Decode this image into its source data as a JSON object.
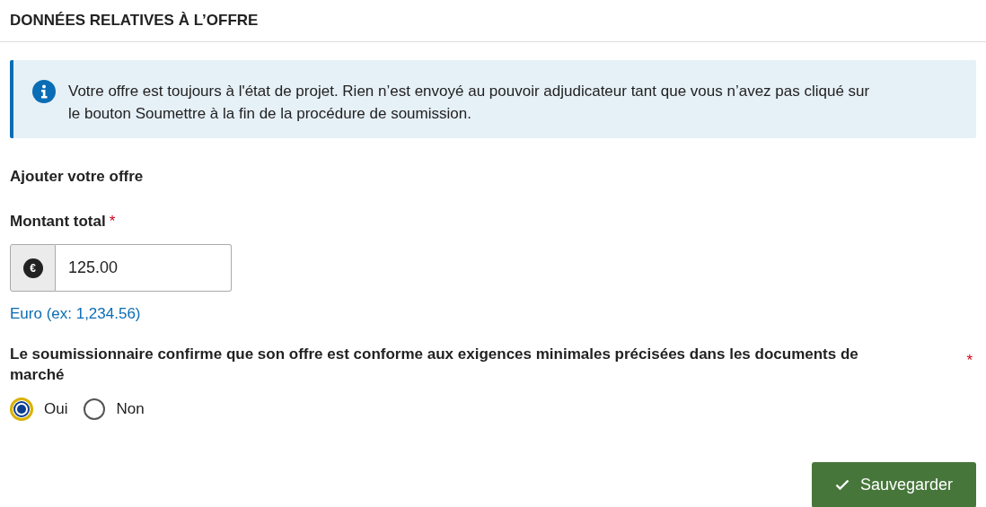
{
  "section_title": "DONNÉES RELATIVES À L’OFFRE",
  "info_message": "Votre offre est toujours à l'état de projet. Rien n’est envoyé au pouvoir adjudicateur tant que vous n’avez pas cliqué sur le bouton Soumettre à la fin de la procédure de soumission.",
  "subtitle": "Ajouter votre offre",
  "amount": {
    "label": "Montant total",
    "required_mark": "*",
    "currency_symbol": "€",
    "value": "125.00",
    "hint": "Euro (ex: 1,234.56)"
  },
  "confirmation": {
    "question": "Le soumissionnaire confirme que son offre est conforme aux exigences minimales précisées dans les documents de marché",
    "required_mark": "*",
    "options": [
      {
        "label": "Oui",
        "selected": true
      },
      {
        "label": "Non",
        "selected": false
      }
    ]
  },
  "save_button": "Sauvegarder"
}
